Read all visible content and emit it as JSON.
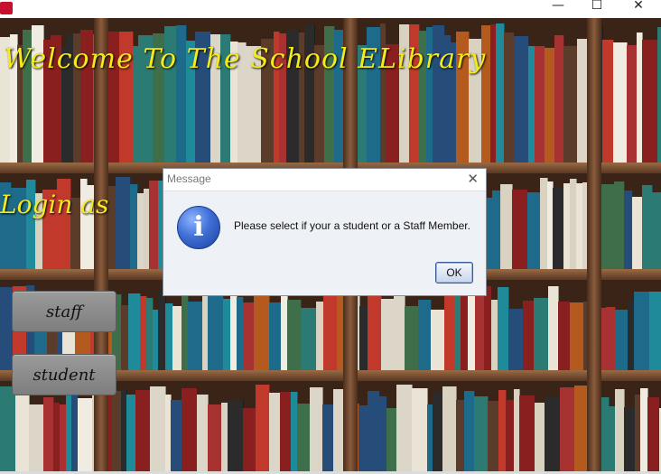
{
  "window": {
    "icons": {
      "app": "java-app-icon",
      "minimize": "minimize-icon",
      "maximize": "maximize-icon",
      "close": "close-icon"
    },
    "minimize_glyph": "—",
    "maximize_glyph": "☐",
    "close_glyph": "✕"
  },
  "main": {
    "welcome_title": "Welcome To The School ELibrary",
    "login_label": "Login as",
    "staff_button": "staff",
    "student_button": "student",
    "background": "bookshelf-photo"
  },
  "dialog": {
    "title": "Message",
    "close_glyph": "✕",
    "icon": "information-icon",
    "icon_glyph": "i",
    "message": "Please select if your a student or a Staff Member.",
    "ok_label": "OK"
  },
  "colors": {
    "title_text": "#f4ea1c",
    "button_bg": "#8a8a8a",
    "dialog_bg": "#eef1f6"
  }
}
